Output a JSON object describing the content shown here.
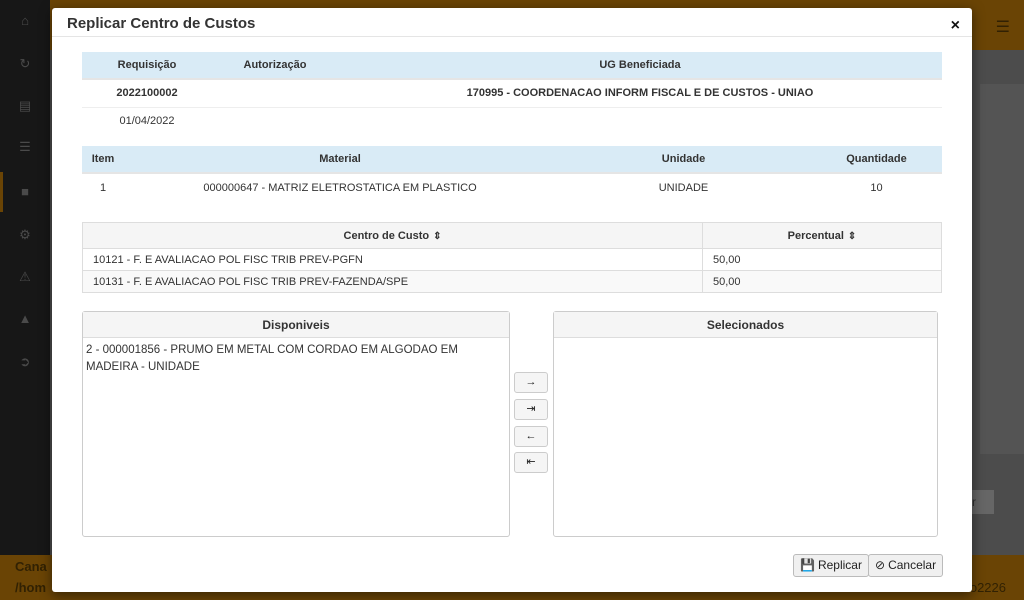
{
  "background": {
    "sidebar_icons": [
      "home-icon",
      "refresh-icon",
      "document-icon",
      "barcode-icon",
      "box-icon",
      "cogs-icon",
      "warning-icon",
      "graduation-icon",
      "logout-icon"
    ],
    "footer_line1": "Cana",
    "footer_line2": "/hom",
    "footer_right": "o2226",
    "bg_button": "tar"
  },
  "modal": {
    "title": "Replicar Centro de Custos",
    "close_label": "×"
  },
  "requisition_table": {
    "headers": [
      "Requisição",
      "Autorização",
      "UG Beneficiada"
    ],
    "row": {
      "requisicao": "2022100002",
      "autorizacao": "",
      "ug": "170995 - COORDENACAO INFORM FISCAL E DE CUSTOS - UNIAO"
    },
    "date": "01/04/2022"
  },
  "material_table": {
    "headers": [
      "Item",
      "Material",
      "Unidade",
      "Quantidade"
    ],
    "row": {
      "item": "1",
      "material": "000000647 - MATRIZ ELETROSTATICA EM PLASTICO",
      "unidade": "UNIDADE",
      "quantidade": "10"
    }
  },
  "cost_center_table": {
    "headers": [
      "Centro de Custo",
      "Percentual"
    ],
    "rows": [
      {
        "centro": "10121 - F. E AVALIACAO POL FISC TRIB PREV-PGFN",
        "percentual": "50,00"
      },
      {
        "centro": "10131 - F. E AVALIACAO POL FISC TRIB PREV-FAZENDA/SPE",
        "percentual": "50,00"
      }
    ]
  },
  "disponiveis": {
    "title": "Disponiveis",
    "items": [
      "2 - 000001856 - PRUMO EM METAL COM CORDAO EM ALGODAO EM MADEIRA - UNIDADE"
    ]
  },
  "selecionados": {
    "title": "Selecionados",
    "items": []
  },
  "move_buttons": {
    "move_right": "→",
    "move_all_right": "⇥",
    "move_left": "←",
    "move_all_left": "⇤"
  },
  "footer": {
    "replicar_label": "Replicar",
    "cancelar_label": "Cancelar"
  },
  "colors": {
    "accent": "#c17d0a",
    "table_header": "#d9ebf6"
  }
}
